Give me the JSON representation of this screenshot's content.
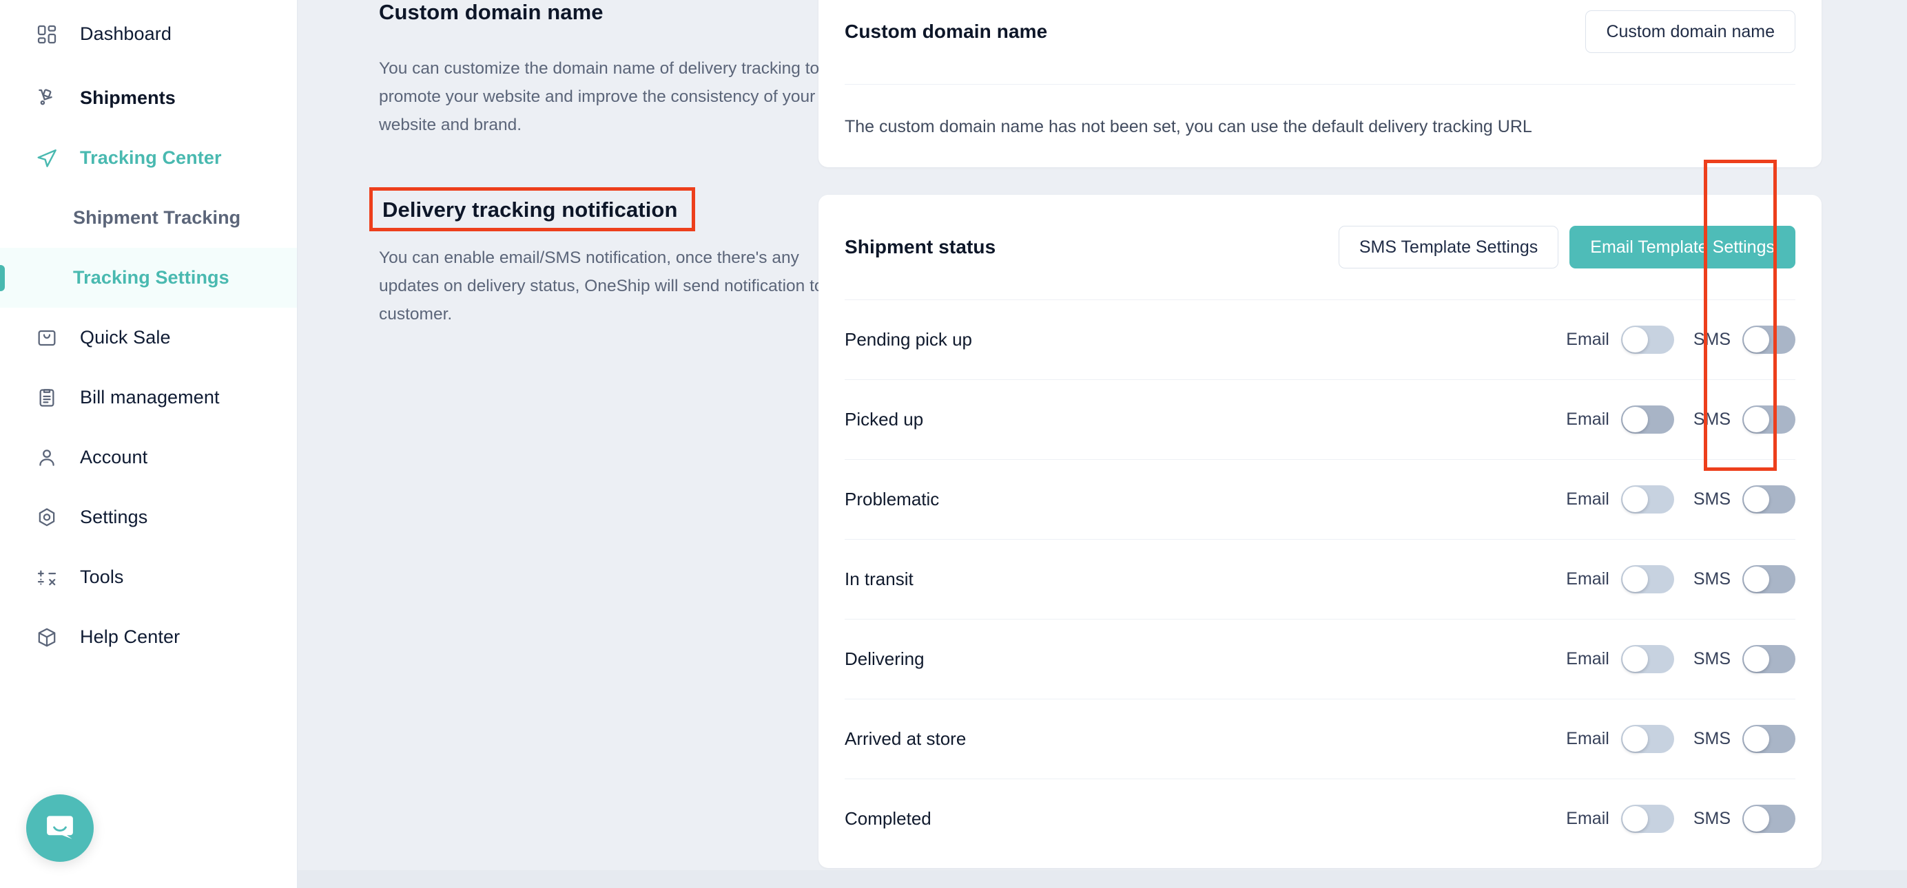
{
  "sidebar": {
    "items": [
      {
        "label": "Dashboard",
        "icon": "dashboard-grid-icon",
        "state": "normal"
      },
      {
        "label": "Shipments",
        "icon": "shipment-cart-icon",
        "state": "bold"
      },
      {
        "label": "Tracking Center",
        "icon": "tracking-send-icon",
        "state": "teal"
      },
      {
        "label": "Quick Sale",
        "icon": "bag-icon",
        "state": "normal"
      },
      {
        "label": "Bill management",
        "icon": "clipboard-icon",
        "state": "normal"
      },
      {
        "label": "Account",
        "icon": "user-icon",
        "state": "normal"
      },
      {
        "label": "Settings",
        "icon": "gear-hex-icon",
        "state": "normal"
      },
      {
        "label": "Tools",
        "icon": "calculator-icon",
        "state": "normal"
      },
      {
        "label": "Help Center",
        "icon": "box-icon",
        "state": "normal"
      }
    ],
    "sub_items": [
      {
        "label": "Shipment Tracking",
        "active": false
      },
      {
        "label": "Tracking Settings",
        "active": true
      }
    ],
    "chat_launcher": "intercom-chat-icon"
  },
  "description": {
    "domain_title": "Custom domain name",
    "domain_text": "You can customize the domain name of delivery tracking to promote your website and improve the consistency of your website and brand.",
    "notification_title": "Delivery tracking notification",
    "notification_text": "You can enable email/SMS notification, once there's any updates on delivery status, OneShip will send notification to the customer."
  },
  "domain_card": {
    "title": "Custom domain name",
    "button": "Custom domain name",
    "note": "The custom domain name has not been set, you can use the default delivery tracking URL"
  },
  "status_card": {
    "title": "Shipment status",
    "sms_button": "SMS Template Settings",
    "email_button": "Email Template Settings",
    "email_label": "Email",
    "sms_label": "SMS",
    "rows": [
      {
        "name": "Pending pick up",
        "email_on": false,
        "email_hover": false,
        "sms_on": false
      },
      {
        "name": "Picked up",
        "email_on": false,
        "email_hover": true,
        "sms_on": false
      },
      {
        "name": "Problematic",
        "email_on": false,
        "email_hover": false,
        "sms_on": false
      },
      {
        "name": "In transit",
        "email_on": false,
        "email_hover": false,
        "sms_on": false
      },
      {
        "name": "Delivering",
        "email_on": false,
        "email_hover": false,
        "sms_on": false
      },
      {
        "name": "Arrived at store",
        "email_on": false,
        "email_hover": false,
        "sms_on": false
      },
      {
        "name": "Completed",
        "email_on": false,
        "email_hover": false,
        "sms_on": false
      }
    ]
  },
  "annotations": {
    "heading_highlight_color": "#ed3f1c",
    "sms_column_highlight_color": "#ed3f1c"
  },
  "colors": {
    "accent_teal": "#4ebcb8",
    "page_background": "#eceff4",
    "card_background": "#ffffff",
    "text_primary": "#0d1628",
    "text_secondary": "#5b6579",
    "toggle_off": "#c7d2e0",
    "toggle_sms_off": "#a9b5c7"
  }
}
